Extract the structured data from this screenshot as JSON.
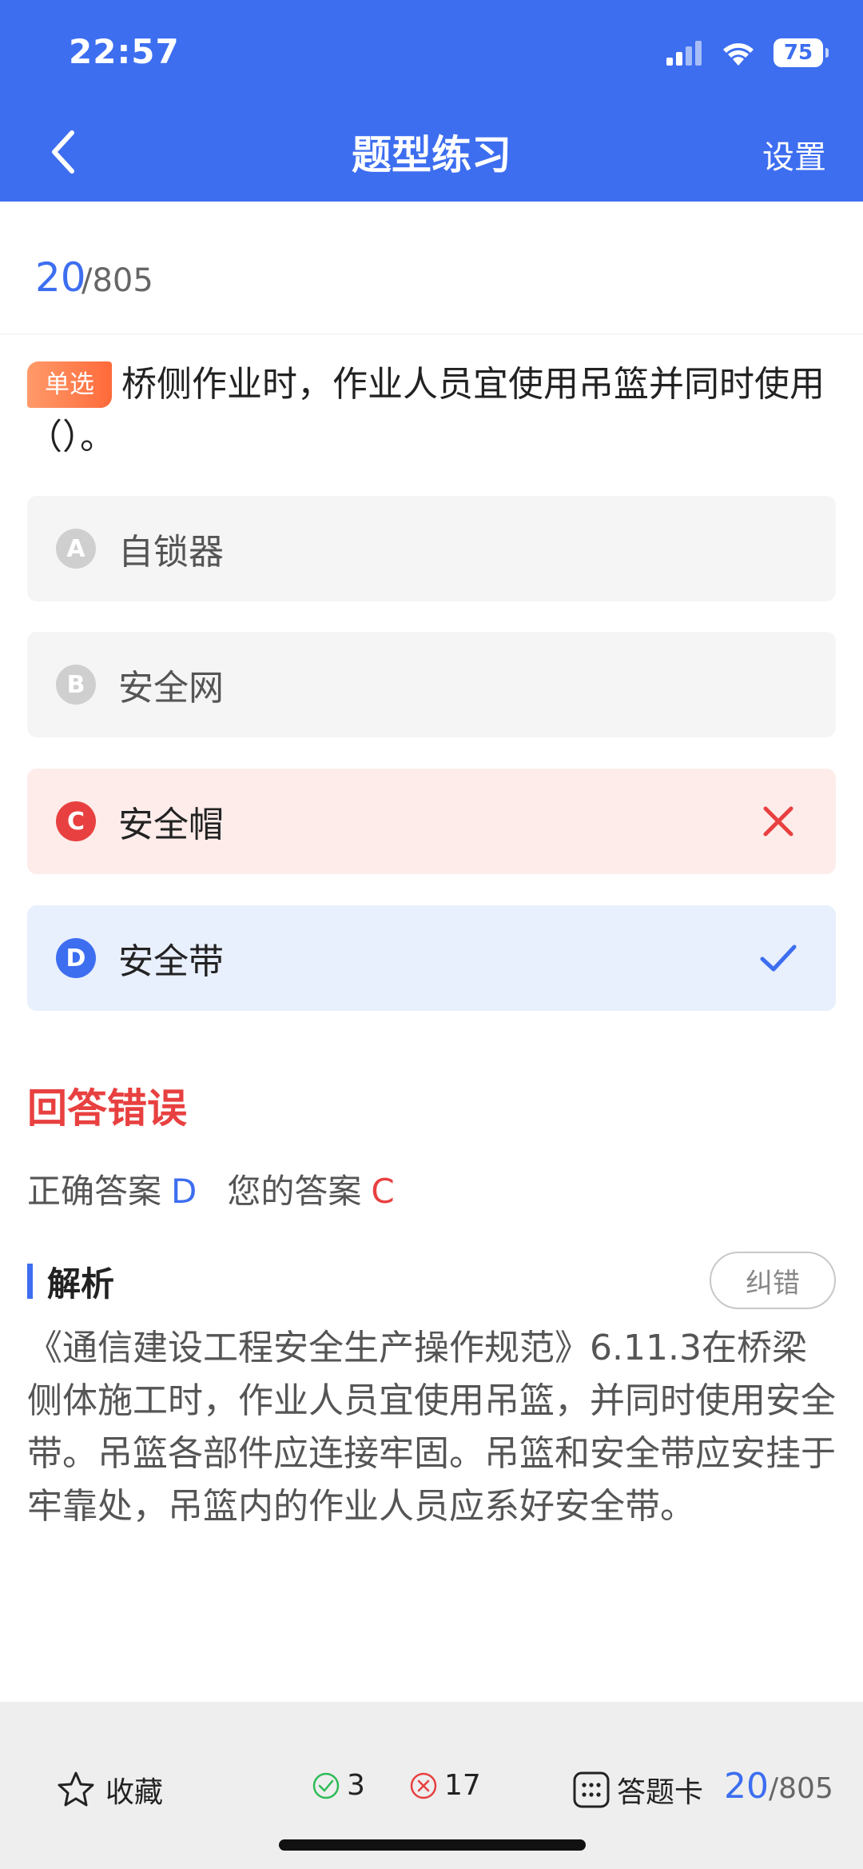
{
  "status_bar": {
    "time": "22:57",
    "battery": "75"
  },
  "header": {
    "title": "题型练习",
    "settings_label": "设置"
  },
  "progress": {
    "current": "20",
    "total": "/805"
  },
  "question": {
    "type_tag": "单选",
    "text": "桥侧作业时，作业人员宜使用吊篮并同时使用（）。"
  },
  "options": [
    {
      "letter": "A",
      "text": "自锁器",
      "state": "normal"
    },
    {
      "letter": "B",
      "text": "安全网",
      "state": "normal"
    },
    {
      "letter": "C",
      "text": "安全帽",
      "state": "wrong"
    },
    {
      "letter": "D",
      "text": "安全带",
      "state": "correct"
    }
  ],
  "result": {
    "title": "回答错误",
    "correct_label": "正确答案",
    "correct_value": "D",
    "yours_label": "您的答案",
    "yours_value": "C"
  },
  "analysis": {
    "label": "解析",
    "report_button": "纠错",
    "text": "《通信建设工程安全生产操作规范》6.11.3在桥梁侧体施工时，作业人员宜使用吊篮，并同时使用安全带。吊篮各部件应连接牢固。吊篮和安全带应安挂于牢靠处，吊篮内的作业人员应系好安全带。"
  },
  "bottom_bar": {
    "favorite_label": "收藏",
    "correct_count": "3",
    "wrong_count": "17",
    "answer_card_label": "答题卡",
    "progress_current": "20",
    "progress_total": "/805"
  },
  "colors": {
    "primary": "#3d6ef0",
    "error": "#e84040",
    "tag": "#ff7a45",
    "success": "#2dbb55"
  }
}
